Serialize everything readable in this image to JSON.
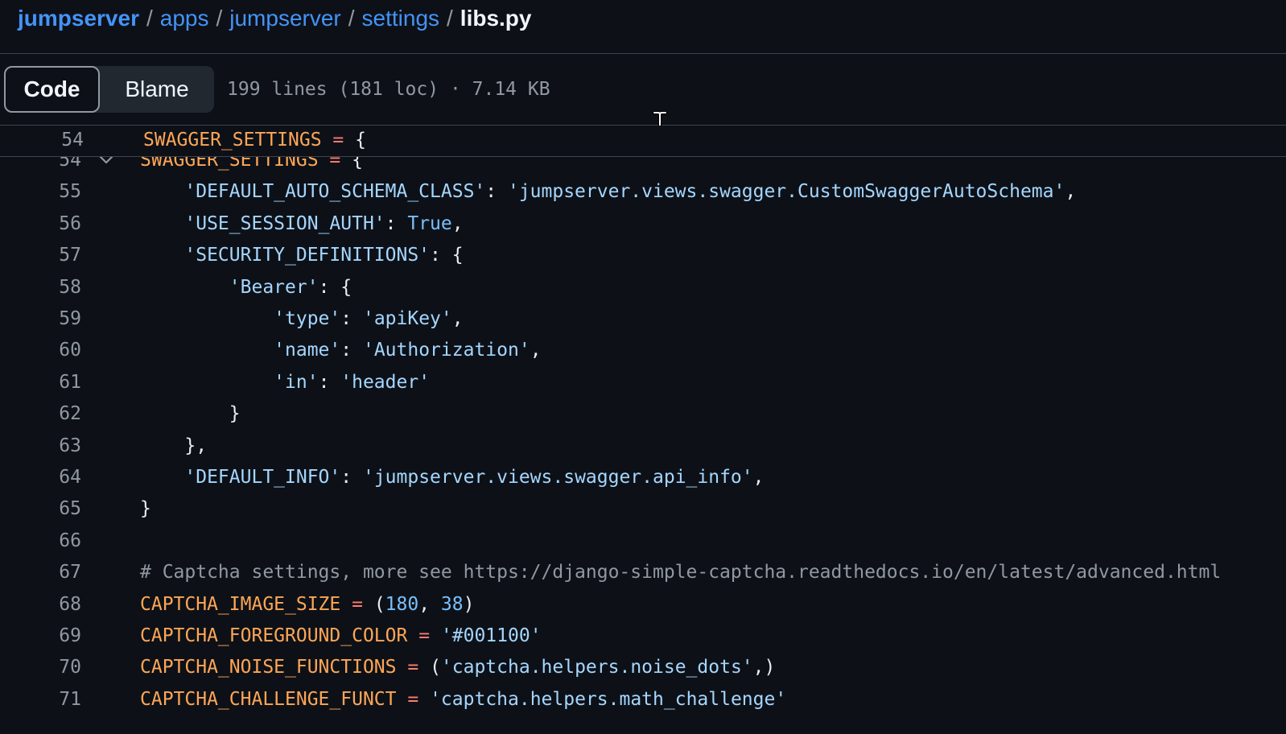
{
  "breadcrumb": {
    "root": "jumpserver",
    "parts": [
      "apps",
      "jumpserver",
      "settings"
    ],
    "current": "libs.py",
    "separator": "/"
  },
  "toolbar": {
    "code_label": "Code",
    "blame_label": "Blame",
    "file_meta": "199 lines (181 loc) · 7.14 KB"
  },
  "sticky": {
    "line_number": "54",
    "code": "SWAGGER_SETTINGS = {"
  },
  "code": {
    "lines": [
      {
        "n": "54",
        "tokens": [
          {
            "t": "var",
            "v": "SWAGGER_SETTINGS"
          },
          {
            "t": "punc",
            "v": " "
          },
          {
            "t": "op",
            "v": "="
          },
          {
            "t": "punc",
            "v": " {"
          }
        ]
      },
      {
        "n": "55",
        "tokens": [
          {
            "t": "punc",
            "v": "    "
          },
          {
            "t": "str",
            "v": "'DEFAULT_AUTO_SCHEMA_CLASS'"
          },
          {
            "t": "punc",
            "v": ": "
          },
          {
            "t": "str",
            "v": "'jumpserver.views.swagger.CustomSwaggerAutoSchema'"
          },
          {
            "t": "punc",
            "v": ","
          }
        ]
      },
      {
        "n": "56",
        "tokens": [
          {
            "t": "punc",
            "v": "    "
          },
          {
            "t": "str",
            "v": "'USE_SESSION_AUTH'"
          },
          {
            "t": "punc",
            "v": ": "
          },
          {
            "t": "const",
            "v": "True"
          },
          {
            "t": "punc",
            "v": ","
          }
        ]
      },
      {
        "n": "57",
        "tokens": [
          {
            "t": "punc",
            "v": "    "
          },
          {
            "t": "str",
            "v": "'SECURITY_DEFINITIONS'"
          },
          {
            "t": "punc",
            "v": ": {"
          }
        ]
      },
      {
        "n": "58",
        "tokens": [
          {
            "t": "punc",
            "v": "        "
          },
          {
            "t": "str",
            "v": "'Bearer'"
          },
          {
            "t": "punc",
            "v": ": {"
          }
        ]
      },
      {
        "n": "59",
        "tokens": [
          {
            "t": "punc",
            "v": "            "
          },
          {
            "t": "str",
            "v": "'type'"
          },
          {
            "t": "punc",
            "v": ": "
          },
          {
            "t": "str",
            "v": "'apiKey'"
          },
          {
            "t": "punc",
            "v": ","
          }
        ]
      },
      {
        "n": "60",
        "tokens": [
          {
            "t": "punc",
            "v": "            "
          },
          {
            "t": "str",
            "v": "'name'"
          },
          {
            "t": "punc",
            "v": ": "
          },
          {
            "t": "str",
            "v": "'Authorization'"
          },
          {
            "t": "punc",
            "v": ","
          }
        ]
      },
      {
        "n": "61",
        "tokens": [
          {
            "t": "punc",
            "v": "            "
          },
          {
            "t": "str",
            "v": "'in'"
          },
          {
            "t": "punc",
            "v": ": "
          },
          {
            "t": "str",
            "v": "'header'"
          }
        ]
      },
      {
        "n": "62",
        "tokens": [
          {
            "t": "punc",
            "v": "        }"
          }
        ]
      },
      {
        "n": "63",
        "tokens": [
          {
            "t": "punc",
            "v": "    },"
          }
        ]
      },
      {
        "n": "64",
        "tokens": [
          {
            "t": "punc",
            "v": "    "
          },
          {
            "t": "str",
            "v": "'DEFAULT_INFO'"
          },
          {
            "t": "punc",
            "v": ": "
          },
          {
            "t": "str",
            "v": "'jumpserver.views.swagger.api_info'"
          },
          {
            "t": "punc",
            "v": ","
          }
        ]
      },
      {
        "n": "65",
        "tokens": [
          {
            "t": "punc",
            "v": "}"
          }
        ]
      },
      {
        "n": "66",
        "tokens": []
      },
      {
        "n": "67",
        "tokens": [
          {
            "t": "com",
            "v": "# Captcha settings, more see https://django-simple-captcha.readthedocs.io/en/latest/advanced.html"
          }
        ]
      },
      {
        "n": "68",
        "tokens": [
          {
            "t": "var",
            "v": "CAPTCHA_IMAGE_SIZE"
          },
          {
            "t": "punc",
            "v": " "
          },
          {
            "t": "op",
            "v": "="
          },
          {
            "t": "punc",
            "v": " ("
          },
          {
            "t": "const",
            "v": "180"
          },
          {
            "t": "punc",
            "v": ", "
          },
          {
            "t": "const",
            "v": "38"
          },
          {
            "t": "punc",
            "v": ")"
          }
        ]
      },
      {
        "n": "69",
        "tokens": [
          {
            "t": "var",
            "v": "CAPTCHA_FOREGROUND_COLOR"
          },
          {
            "t": "punc",
            "v": " "
          },
          {
            "t": "op",
            "v": "="
          },
          {
            "t": "punc",
            "v": " "
          },
          {
            "t": "str",
            "v": "'#001100'"
          }
        ]
      },
      {
        "n": "70",
        "tokens": [
          {
            "t": "var",
            "v": "CAPTCHA_NOISE_FUNCTIONS"
          },
          {
            "t": "punc",
            "v": " "
          },
          {
            "t": "op",
            "v": "="
          },
          {
            "t": "punc",
            "v": " ("
          },
          {
            "t": "str",
            "v": "'captcha.helpers.noise_dots'"
          },
          {
            "t": "punc",
            "v": ",)"
          }
        ]
      },
      {
        "n": "71",
        "tokens": [
          {
            "t": "var",
            "v": "CAPTCHA_CHALLENGE_FUNCT"
          },
          {
            "t": "punc",
            "v": " "
          },
          {
            "t": "op",
            "v": "="
          },
          {
            "t": "punc",
            "v": " "
          },
          {
            "t": "str",
            "v": "'captcha.helpers.math_challenge'"
          }
        ]
      }
    ]
  },
  "colors": {
    "background": "#0d1117",
    "link": "#4493f8",
    "variable": "#ffa657",
    "operator": "#ff7b72",
    "string": "#a5d6ff",
    "constant": "#79c0ff",
    "comment": "#9198a1"
  },
  "icons": {
    "fold": "chevron-down-icon",
    "cursor": "text-cursor-icon"
  }
}
